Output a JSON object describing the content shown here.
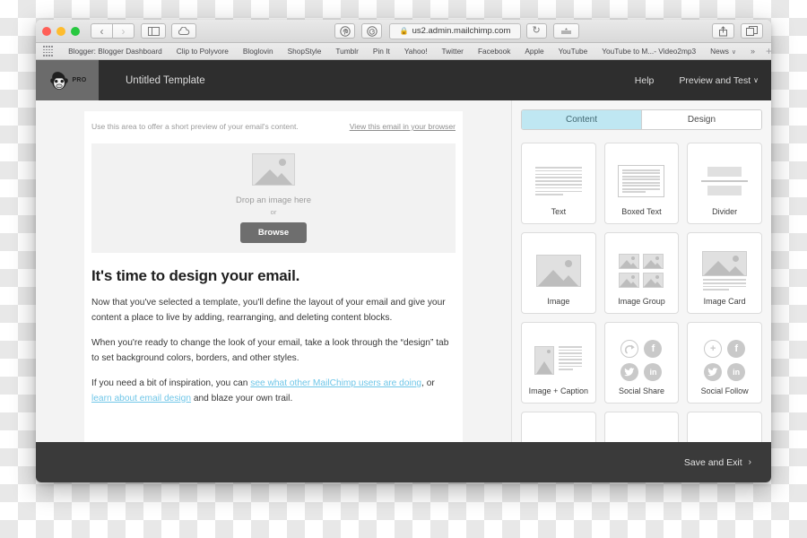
{
  "browser": {
    "url": "us2.admin.mailchimp.com",
    "lock_icon": "lock-icon",
    "back_icon": "‹",
    "forward_icon": "›",
    "sidebar_icon": "sidebar-icon",
    "cloud_icon": "cloud-icon",
    "pinterest_icon": "pinterest-icon",
    "extension_icon": "extension-icon",
    "reload_icon": "↻",
    "reader_icon": "reader-icon",
    "share_icon": "share-icon",
    "tabs_icon": "tabs-icon",
    "bookmarks": [
      {
        "label": "Blogger: Blogger Dashboard"
      },
      {
        "label": "Clip to Polyvore"
      },
      {
        "label": "Bloglovin"
      },
      {
        "label": "ShopStyle"
      },
      {
        "label": "Tumblr"
      },
      {
        "label": "Pin It"
      },
      {
        "label": "Yahoo!"
      },
      {
        "label": "Twitter"
      },
      {
        "label": "Facebook"
      },
      {
        "label": "Apple"
      },
      {
        "label": "YouTube"
      },
      {
        "label": "YouTube to M...- Video2mp3"
      },
      {
        "label": "News",
        "caret": "∨"
      }
    ],
    "overflow_label": "»",
    "add_label": "+"
  },
  "app_header": {
    "brand": "PRO",
    "template_title": "Untitled Template",
    "help_label": "Help",
    "preview_label": "Preview and Test",
    "preview_caret": "∨"
  },
  "email": {
    "preheader_text": "Use this area to offer a short preview of your email's content.",
    "browser_link": "View this email in your browser",
    "dropzone": {
      "label": "Drop an image here",
      "or": "or",
      "browse_label": "Browse"
    },
    "heading": "It's time to design your email.",
    "paragraph_1": "Now that you've selected a template, you'll define the layout of your email and give your content a place to live by adding, rearranging, and deleting content blocks.",
    "paragraph_2": "When you're ready to change the look of your email, take a look through the “design” tab to set background colors, borders, and other styles.",
    "paragraph_3_pre": "If you need a bit of inspiration, you can ",
    "paragraph_3_link1": "see what other MailChimp users are doing",
    "paragraph_3_mid": ", or ",
    "paragraph_3_link2": "learn about email design",
    "paragraph_3_post": " and blaze your own trail."
  },
  "sidebar": {
    "tabs": [
      {
        "label": "Content",
        "active": true
      },
      {
        "label": "Design",
        "active": false
      }
    ],
    "blocks": [
      {
        "label": "Text",
        "icon": "text-lines-icon"
      },
      {
        "label": "Boxed Text",
        "icon": "boxed-text-icon"
      },
      {
        "label": "Divider",
        "icon": "divider-icon"
      },
      {
        "label": "Image",
        "icon": "image-icon"
      },
      {
        "label": "Image Group",
        "icon": "image-group-icon"
      },
      {
        "label": "Image Card",
        "icon": "image-card-icon"
      },
      {
        "label": "Image + Caption",
        "icon": "image-caption-icon"
      },
      {
        "label": "Social Share",
        "icon": "social-share-icon"
      },
      {
        "label": "Social Follow",
        "icon": "social-follow-icon"
      }
    ]
  },
  "footer": {
    "save_label": "Save and Exit",
    "chevron": "›"
  },
  "colors": {
    "accent_tab": "#bfe7f2",
    "link": "#6fc6e8",
    "header_bg": "#2e2e2e",
    "footer_bg": "#3a3a3a",
    "browse_button": "#6e6e6e"
  }
}
